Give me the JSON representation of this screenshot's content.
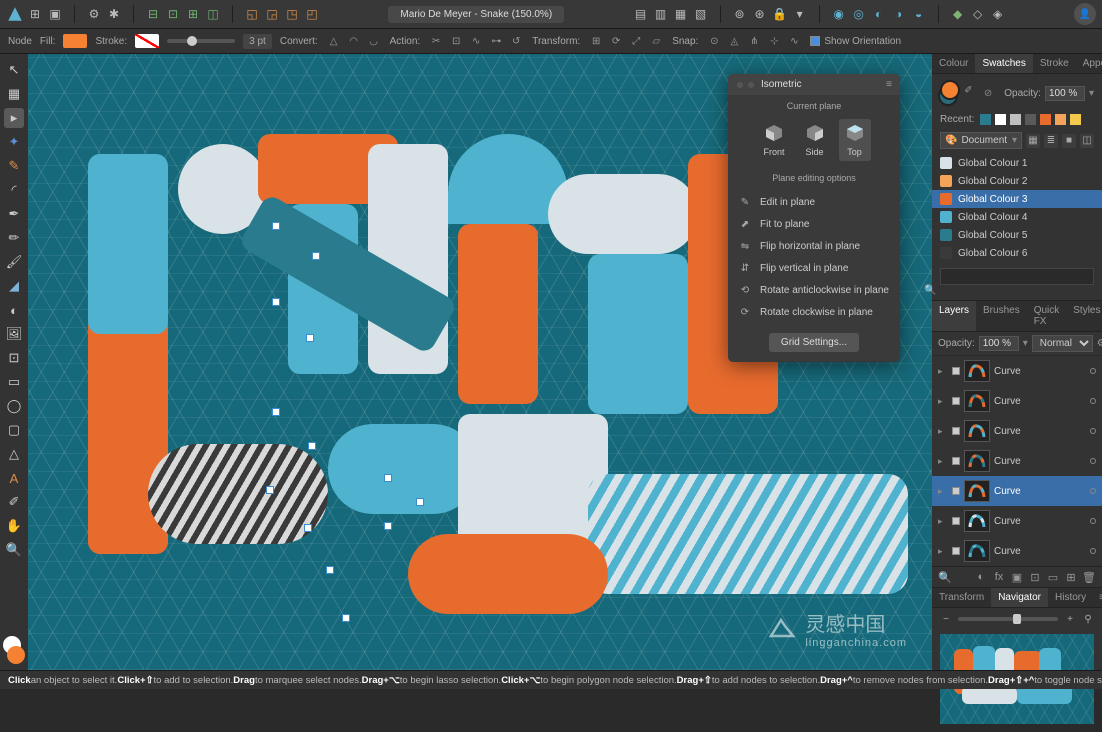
{
  "document": {
    "title": "Mario De Meyer - Snake (150.0%)"
  },
  "context": {
    "tool_label": "Node",
    "fill_label": "Fill:",
    "stroke_label": "Stroke:",
    "stroke_value": "3 pt",
    "convert_label": "Convert:",
    "action_label": "Action:",
    "transform_label": "Transform:",
    "snap_label": "Snap:",
    "show_orientation": "Show Orientation"
  },
  "isometric": {
    "title": "Isometric",
    "current_plane": "Current plane",
    "planes": {
      "front": "Front",
      "side": "Side",
      "top": "Top"
    },
    "editing_title": "Plane editing options",
    "options": [
      "Edit in plane",
      "Fit to plane",
      "Flip horizontal in plane",
      "Flip vertical in plane",
      "Rotate anticlockwise in plane",
      "Rotate clockwise in plane"
    ],
    "grid_button": "Grid Settings..."
  },
  "swatches": {
    "tabs": {
      "colour": "Colour",
      "swatches": "Swatches",
      "stroke": "Stroke",
      "appearance": "Appearance"
    },
    "opacity_label": "Opacity:",
    "opacity_value": "100 %",
    "recent_label": "Recent:",
    "recent": [
      "#2b7b8f",
      "#ffffff",
      "#bfbfbf",
      "#5a5a5a",
      "#e86b2e",
      "#f5a25a",
      "#f2c94c"
    ],
    "doc_select": "Document",
    "globals": [
      {
        "name": "Global Colour 1",
        "hex": "#d9e3e7"
      },
      {
        "name": "Global Colour 2",
        "hex": "#f6a35a"
      },
      {
        "name": "Global Colour 3",
        "hex": "#e86b2e"
      },
      {
        "name": "Global Colour 4",
        "hex": "#4fb3cf"
      },
      {
        "name": "Global Colour 5",
        "hex": "#2b7b8f"
      },
      {
        "name": "Global Colour 6",
        "hex": "#3a3a3a"
      }
    ],
    "selected_index": 2
  },
  "layers": {
    "tabs": {
      "layers": "Layers",
      "brushes": "Brushes",
      "quickfx": "Quick FX",
      "styles": "Styles"
    },
    "opacity_label": "Opacity:",
    "opacity_value": "100 %",
    "blend_mode": "Normal",
    "items": [
      {
        "name": "Curve",
        "c1": "#e86b2e",
        "c2": "#4fb3cf"
      },
      {
        "name": "Curve",
        "c1": "#e86b2e",
        "c2": "#2b7b8f"
      },
      {
        "name": "Curve",
        "c1": "#4fb3cf",
        "c2": "#e86b2e"
      },
      {
        "name": "Curve",
        "c1": "#2b7b8f",
        "c2": "#e86b2e"
      },
      {
        "name": "Curve",
        "c1": "#e86b2e",
        "c2": "#4fb3cf"
      },
      {
        "name": "Curve",
        "c1": "#4fb3cf",
        "c2": "#d9e3e7"
      },
      {
        "name": "Curve",
        "c1": "#2b7b8f",
        "c2": "#4fb3cf"
      }
    ],
    "selected_index": 4
  },
  "navigator": {
    "tabs": {
      "transform": "Transform",
      "navigator": "Navigator",
      "history": "History"
    }
  },
  "status": {
    "t1": "Click",
    "t2": " an object to select it. ",
    "t3": "Click+⇧",
    "t4": " to add to selection. ",
    "t5": "Drag",
    "t6": " to marquee select nodes. ",
    "t7": "Drag+⌥",
    "t8": " to begin lasso selection. ",
    "t9": "Click+⌥",
    "t10": " to begin polygon node selection. ",
    "t11": "Drag+⇧",
    "t12": " to add nodes to selection. ",
    "t13": "Drag+^",
    "t14": " to remove nodes from selection. ",
    "t15": "Drag+⇧+^",
    "t16": " to toggle node selection."
  },
  "watermark": {
    "brand": "灵感中国",
    "url": "lingganchina.com"
  }
}
